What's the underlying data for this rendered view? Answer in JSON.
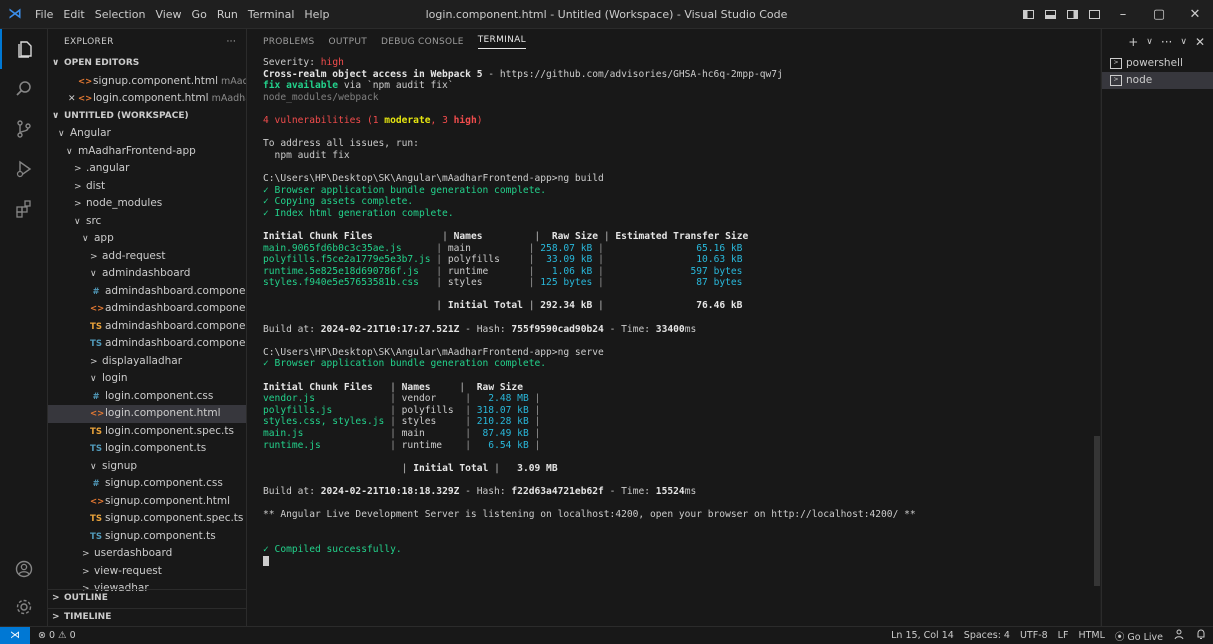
{
  "titlebar": {
    "logo": "⋊",
    "menu": [
      "File",
      "Edit",
      "Selection",
      "View",
      "Go",
      "Run",
      "Terminal",
      "Help"
    ],
    "title": "login.component.html - Untitled (Workspace) - Visual Studio Code",
    "minimize": "–",
    "maximize": "▢",
    "close": "✕"
  },
  "sidebar": {
    "header": "EXPLORER",
    "more": "···",
    "open_editors": {
      "label": "OPEN EDITORS",
      "items": [
        {
          "name": "signup.component.html",
          "desc": "mAadh..."
        },
        {
          "name": "login.component.html",
          "desc": "mAadhar...",
          "close": "✕"
        }
      ]
    },
    "workspace": {
      "label": "UNTITLED (WORKSPACE)",
      "tree": [
        {
          "label": "Angular"
        },
        {
          "label": "mAadharFrontend-app"
        },
        {
          "label": ".angular"
        },
        {
          "label": "dist"
        },
        {
          "label": "node_modules"
        },
        {
          "label": "src"
        },
        {
          "label": "app"
        },
        {
          "label": "add-request"
        },
        {
          "label": "admindashboard"
        },
        {
          "label": "admindashboard.component...."
        },
        {
          "label": "admindashboard.component...."
        },
        {
          "label": "admindashboard.component...."
        },
        {
          "label": "admindashboard.component.ts"
        },
        {
          "label": "displayalladhar"
        },
        {
          "label": "login"
        },
        {
          "label": "login.component.css"
        },
        {
          "label": "login.component.html"
        },
        {
          "label": "login.component.spec.ts"
        },
        {
          "label": "login.component.ts"
        },
        {
          "label": "signup"
        },
        {
          "label": "signup.component.css"
        },
        {
          "label": "signup.component.html"
        },
        {
          "label": "signup.component.spec.ts"
        },
        {
          "label": "signup.component.ts"
        },
        {
          "label": "userdashboard"
        },
        {
          "label": "view-request"
        },
        {
          "label": "viewadhar"
        }
      ]
    },
    "outline": "OUTLINE",
    "timeline": "TIMELINE"
  },
  "panel": {
    "tabs": [
      "PROBLEMS",
      "OUTPUT",
      "DEBUG CONSOLE",
      "TERMINAL"
    ],
    "active_tab": "TERMINAL"
  },
  "terminal": {
    "severity_label": "Severity: ",
    "severity_value": "high",
    "advisory_title": "Cross-realm object access in Webpack 5",
    "advisory_url": " - https://github.com/advisories/GHSA-hc6q-2mpp-qw7j",
    "fix_available": "fix available",
    "fix_via": " via `npm audit fix`",
    "module_path": "node_modules/webpack",
    "vuln_count": "4 vulnerabilities (1 ",
    "vuln_moderate": "moderate",
    "vuln_sep": ", 3 ",
    "vuln_high": "high",
    "vuln_end": ")",
    "address_line": "To address all issues, run:",
    "audit_cmd": "  npm audit fix",
    "prompt_build": "C:\\Users\\HP\\Desktop\\SK\\Angular\\mAadharFrontend-app>ng build",
    "build_steps": [
      "✓ Browser application bundle generation complete.",
      "✓ Copying assets complete.",
      "✓ Index html generation complete."
    ],
    "build_header": [
      "Initial Chunk Files",
      "Names",
      "Raw Size",
      "Estimated Transfer Size"
    ],
    "build_rows": [
      {
        "file": "main.9065fd6b0c3c35ae.js",
        "name": "main",
        "raw": "258.07 kB",
        "est": "65.16 kB"
      },
      {
        "file": "polyfills.f5ce2a1779e5e3b7.js",
        "name": "polyfills",
        "raw": "33.09 kB",
        "est": "10.63 kB"
      },
      {
        "file": "runtime.5e825e18d690786f.js",
        "name": "runtime",
        "raw": "1.06 kB",
        "est": "597 bytes"
      },
      {
        "file": "styles.f940e5e57653581b.css",
        "name": "styles",
        "raw": "125 bytes",
        "est": "87 bytes"
      }
    ],
    "build_total_label": "Initial Total",
    "build_total_raw": "292.34 kB",
    "build_total_est": "76.46 kB",
    "build_at_label": "Build at: ",
    "build_at_date": "2024-02-21",
    "build_at_time": "T10:17:27.521Z",
    "build_hash_label": " - Hash: ",
    "build_hash": "755f9590cad90b24",
    "build_time_label": " - Time: ",
    "build_time": "33400",
    "ms": "ms",
    "prompt_serve": "C:\\Users\\HP\\Desktop\\SK\\Angular\\mAadharFrontend-app>ng serve",
    "serve_step": "✓ Browser application bundle generation complete.",
    "serve_header": [
      "Initial Chunk Files",
      "Names",
      "Raw Size"
    ],
    "serve_rows": [
      {
        "file": "vendor.js",
        "name": "vendor",
        "raw": "2.48 MB"
      },
      {
        "file": "polyfills.js",
        "name": "polyfills",
        "raw": "318.07 kB"
      },
      {
        "file": "styles.css, styles.js",
        "name": "styles",
        "raw": "210.28 kB"
      },
      {
        "file": "main.js",
        "name": "main",
        "raw": "87.49 kB"
      },
      {
        "file": "runtime.js",
        "name": "runtime",
        "raw": "6.54 kB"
      }
    ],
    "serve_total_label": "Initial Total",
    "serve_total_raw": "3.09 MB",
    "serve_at_date": "2024-02-21",
    "serve_at_time": "T10:18:18.329Z",
    "serve_hash": "f22d63a4721eb62f",
    "serve_time": "15524",
    "live_server": "** Angular Live Development Server is listening on localhost:4200, open your browser on http://localhost:4200/ **",
    "compiled": "✓ Compiled successfully."
  },
  "terminal_list": {
    "actions": [
      "+",
      "∨",
      "···",
      "∨",
      "✕"
    ],
    "entries": [
      "powershell",
      "node"
    ],
    "active": "node"
  },
  "statusbar": {
    "remote": "⋊",
    "problems": "⊗ 0  ⚠ 0",
    "position": "Ln 15, Col 14",
    "spaces": "Spaces: 4",
    "encoding": "UTF-8",
    "eol": "LF",
    "language": "HTML",
    "golive": "⦿ Go Live"
  }
}
